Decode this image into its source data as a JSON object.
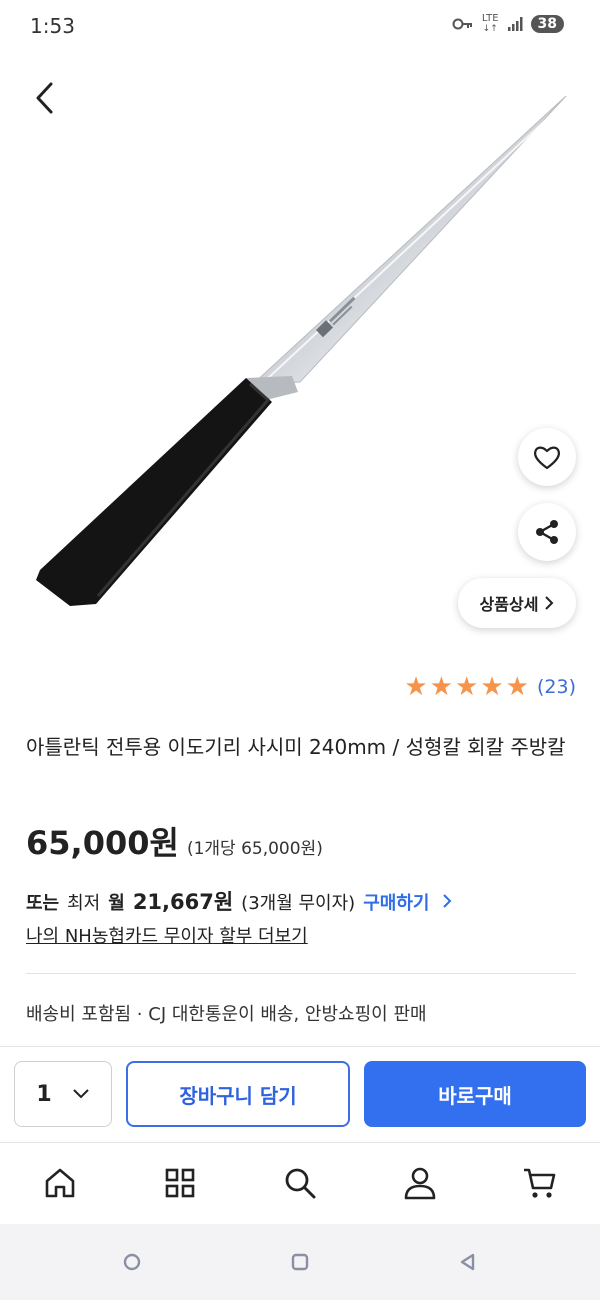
{
  "status": {
    "time": "1:53",
    "network": "LTE",
    "battery": "38"
  },
  "icons": {
    "back": "chevron-left-icon",
    "wish": "heart-icon",
    "share": "share-icon"
  },
  "product": {
    "detail_label": "상품상세",
    "rating": {
      "stars": 5,
      "max": 5,
      "count": "(23)"
    },
    "title": "아틀란틱 전투용 이도기리 사시미 240mm / 성형칼 회칼 주방칼",
    "price": "65,000원",
    "unit_price": "(1개당 65,000원)",
    "installment": {
      "prefix": "또는",
      "label": "최저",
      "month": "월",
      "amount": "21,667원",
      "term": "(3개월 무이자)",
      "buy_link": "구매하기"
    },
    "card_link": "나의 NH농협카드 무이자 할부 더보기",
    "delivery": "배송비 포함됨 ·  CJ 대한통운이 배송, 안방쇼핑이 판매"
  },
  "actions": {
    "quantity": "1",
    "cart": "장바구니 담기",
    "buy": "바로구매"
  },
  "colors": {
    "accent": "#3370f0",
    "star": "#f5944a",
    "link": "#3d6cd6"
  }
}
